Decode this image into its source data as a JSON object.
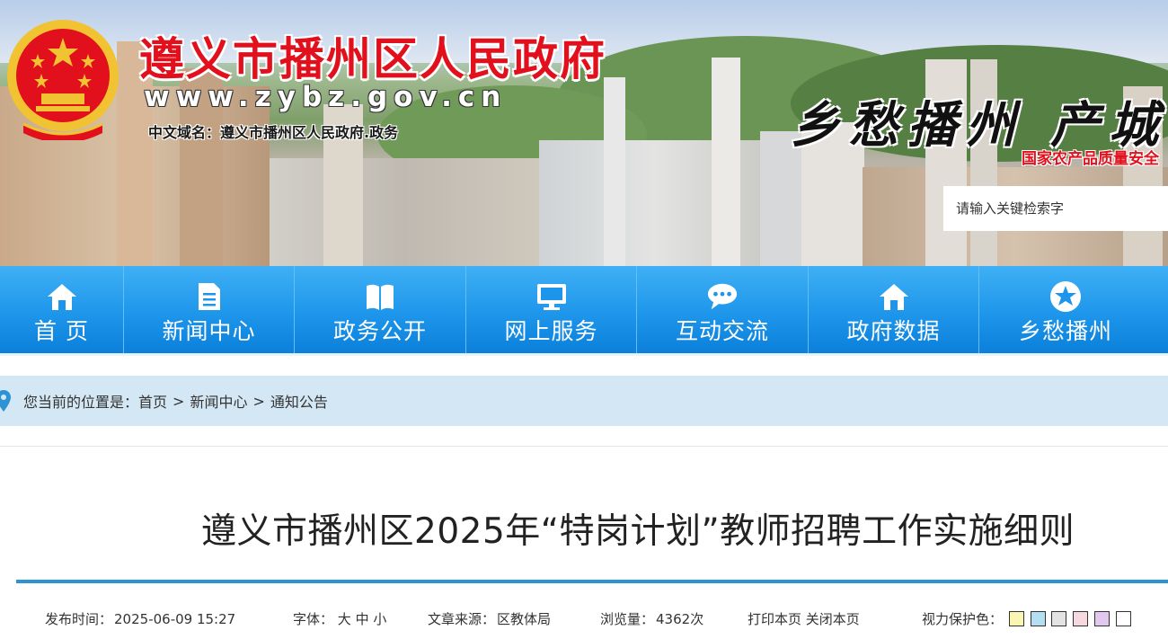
{
  "header": {
    "site_title": "遵义市播州区人民政府",
    "site_url": "www.zybz.gov.cn",
    "site_domain": "中文域名：遵义市播州区人民政府.政务",
    "slogan": "乡愁播州 产城",
    "sub_slogan": "国家农产品质量安全",
    "search_placeholder": "请输入关键检索字"
  },
  "nav": {
    "items": [
      {
        "label": "首 页",
        "icon": "home-icon"
      },
      {
        "label": "新闻中心",
        "icon": "document-icon"
      },
      {
        "label": "政务公开",
        "icon": "book-icon"
      },
      {
        "label": "网上服务",
        "icon": "monitor-icon"
      },
      {
        "label": "互动交流",
        "icon": "chat-icon"
      },
      {
        "label": "政府数据",
        "icon": "building-icon"
      },
      {
        "label": "乡愁播州",
        "icon": "star-icon"
      }
    ]
  },
  "breadcrumb": {
    "prefix": "您当前的位置是：",
    "items": [
      "首页",
      "新闻中心",
      "通知公告"
    ],
    "separator": ">"
  },
  "article": {
    "title": "遵义市播州区2025年“特岗计划”教师招聘工作实施细则",
    "publish_label": "发布时间：",
    "publish_time": "2025-06-09 15:27",
    "font_label": "字体：",
    "font_sizes": [
      "大",
      "中",
      "小"
    ],
    "source_label": "文章来源：",
    "source": "区教体局",
    "views_label": "浏览量：",
    "views": "4362次",
    "print_label": "打印本页",
    "close_label": "关闭本页",
    "eye_care_label": "视力保护色：",
    "eye_care_colors": [
      "#faf5b3",
      "#b5dff0",
      "#e3e3e3",
      "#f5d9df",
      "#e0c8ee",
      "#ffffff"
    ]
  },
  "colors": {
    "nav_blue": "#1d95ea",
    "title_red": "#e1101c",
    "rule_blue": "#2d93d2",
    "crumb_bg": "#d4e7f4"
  }
}
